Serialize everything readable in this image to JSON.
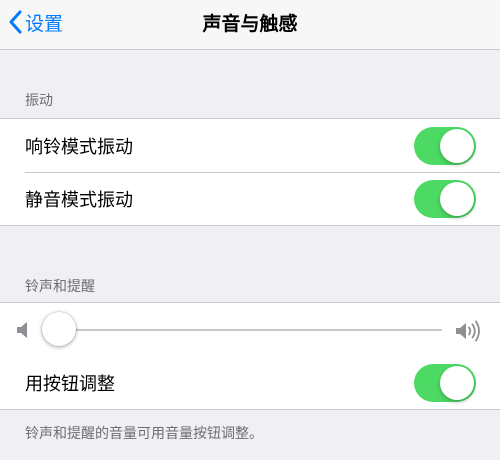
{
  "nav": {
    "back_label": "设置",
    "title": "声音与触感"
  },
  "vibration": {
    "header": "振动",
    "items": [
      {
        "label": "响铃模式振动",
        "on": true
      },
      {
        "label": "静音模式振动",
        "on": true
      }
    ]
  },
  "ringer": {
    "header": "铃声和提醒",
    "volume_fraction": 0.03,
    "change_with_buttons": {
      "label": "用按钮调整",
      "on": true
    },
    "footer": "铃声和提醒的音量可用音量按钮调整。"
  },
  "colors": {
    "accent": "#007aff",
    "toggle_on": "#4cd964"
  },
  "icons": [
    "chevron-left-icon",
    "speaker-low-icon",
    "speaker-high-icon"
  ]
}
